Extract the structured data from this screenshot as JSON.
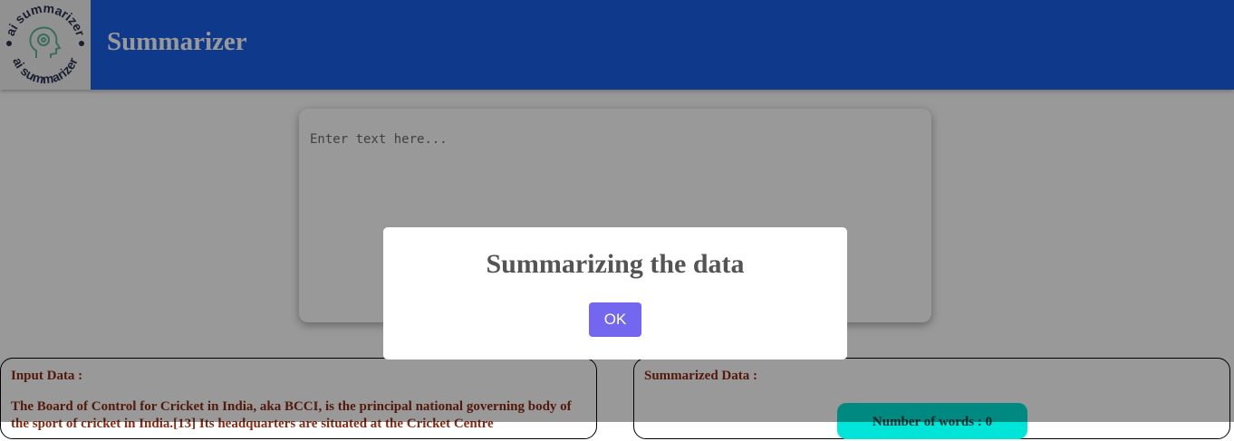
{
  "header": {
    "title": "Summarizer",
    "logo_text_top": "ai summarizer",
    "logo_text_bottom": "ai summarizer",
    "background_color": "#1a5fe8"
  },
  "editor": {
    "placeholder": "Enter text here..."
  },
  "input_panel": {
    "title": "Input Data :",
    "text": "The Board of Control for Cricket in India, aka BCCI, is the principal national governing body of the sport of cricket in India.[13] Its headquarters are situated at the Cricket Centre"
  },
  "summary_panel": {
    "title": "Summarized Data :",
    "badge_text": "Number of words : 0"
  },
  "dialog": {
    "title": "Summarizing the data",
    "ok_label": "OK",
    "button_color": "#7367f0"
  },
  "icons": {
    "logo": "brain-head-gear-icon"
  }
}
